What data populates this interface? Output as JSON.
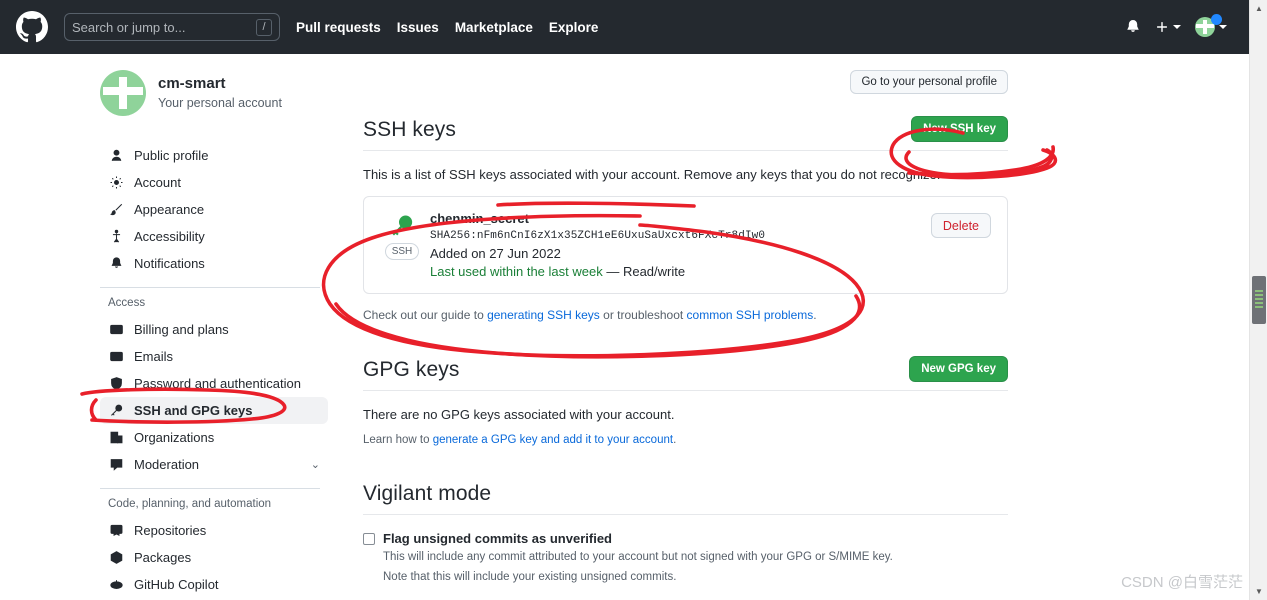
{
  "header": {
    "logo_icon": "github-logo-icon",
    "search": {
      "placeholder": "Search or jump to...",
      "shortcut": "/"
    },
    "nav": [
      {
        "label": "Pull requests"
      },
      {
        "label": "Issues"
      },
      {
        "label": "Marketplace"
      },
      {
        "label": "Explore"
      }
    ],
    "notifications_icon": "bell-icon",
    "create_new_icon": "plus-icon",
    "avatar_icon": "user-avatar"
  },
  "sidebar": {
    "account_name": "cm-smart",
    "account_sub": "Your personal account",
    "items": [
      {
        "label": "Public profile",
        "icon": "person-icon",
        "active": false
      },
      {
        "label": "Account",
        "icon": "gear-icon",
        "active": false
      },
      {
        "label": "Appearance",
        "icon": "paintbrush-icon",
        "active": false
      },
      {
        "label": "Accessibility",
        "icon": "accessibility-icon",
        "active": false
      },
      {
        "label": "Notifications",
        "icon": "bell-icon",
        "active": false
      }
    ],
    "group_access": "Access",
    "access_items": [
      {
        "label": "Billing and plans",
        "icon": "credit-card-icon",
        "active": false
      },
      {
        "label": "Emails",
        "icon": "mail-icon",
        "active": false
      },
      {
        "label": "Password and authentication",
        "icon": "shield-icon",
        "active": false
      },
      {
        "label": "SSH and GPG keys",
        "icon": "key-icon",
        "active": true
      },
      {
        "label": "Organizations",
        "icon": "organization-icon",
        "active": false
      },
      {
        "label": "Moderation",
        "icon": "report-icon",
        "active": false,
        "chevron": "⌄"
      }
    ],
    "group_code": "Code, planning, and automation",
    "code_items": [
      {
        "label": "Repositories",
        "icon": "repo-icon",
        "active": false
      },
      {
        "label": "Packages",
        "icon": "package-icon",
        "active": false
      },
      {
        "label": "GitHub Copilot",
        "icon": "copilot-icon",
        "active": false
      }
    ]
  },
  "main": {
    "personal_profile_button": "Go to your personal profile",
    "ssh": {
      "title": "SSH keys",
      "new_button": "New SSH key",
      "description": "This is a list of SSH keys associated with your account. Remove any keys that you do not recognize.",
      "key": {
        "icon": "key-icon",
        "badge": "SSH",
        "title": "chenmin_secret",
        "fingerprint": "SHA256:nFm6nCnI6zX1x35ZCH1eE6UxuSaUxcxt6FXcTr8dIw0",
        "added": "Added on 27 Jun 2022",
        "last_used": "Last used within the last week",
        "permission": "— Read/write",
        "delete_button": "Delete"
      },
      "guide_prefix": "Check out our guide to ",
      "guide_link1": "generating SSH keys",
      "guide_middle": " or troubleshoot ",
      "guide_link2": "common SSH problems",
      "guide_suffix": "."
    },
    "gpg": {
      "title": "GPG keys",
      "new_button": "New GPG key",
      "empty": "There are no GPG keys associated with your account.",
      "learn_prefix": "Learn how to ",
      "learn_link": "generate a GPG key and add it to your account",
      "learn_suffix": "."
    },
    "vigilant": {
      "title": "Vigilant mode",
      "checkbox_label": "Flag unsigned commits as unverified",
      "note1": "This will include any commit attributed to your account but not signed with your GPG or S/MIME key.",
      "note2": "Note that this will include your existing unsigned commits."
    }
  },
  "annotations": {
    "color": "#e8202a",
    "marks": [
      "ellipse-around-new-ssh-key-button",
      "underline-under-description",
      "ellipse-around-ssh-key-card",
      "underline-and-arrow-on-sidebar-ssh-and-gpg-keys"
    ]
  },
  "watermark": {
    "text": "CSDN @白雪茫茫"
  },
  "scrollbar": {
    "up_arrow": "▲",
    "down_arrow": "▼"
  }
}
